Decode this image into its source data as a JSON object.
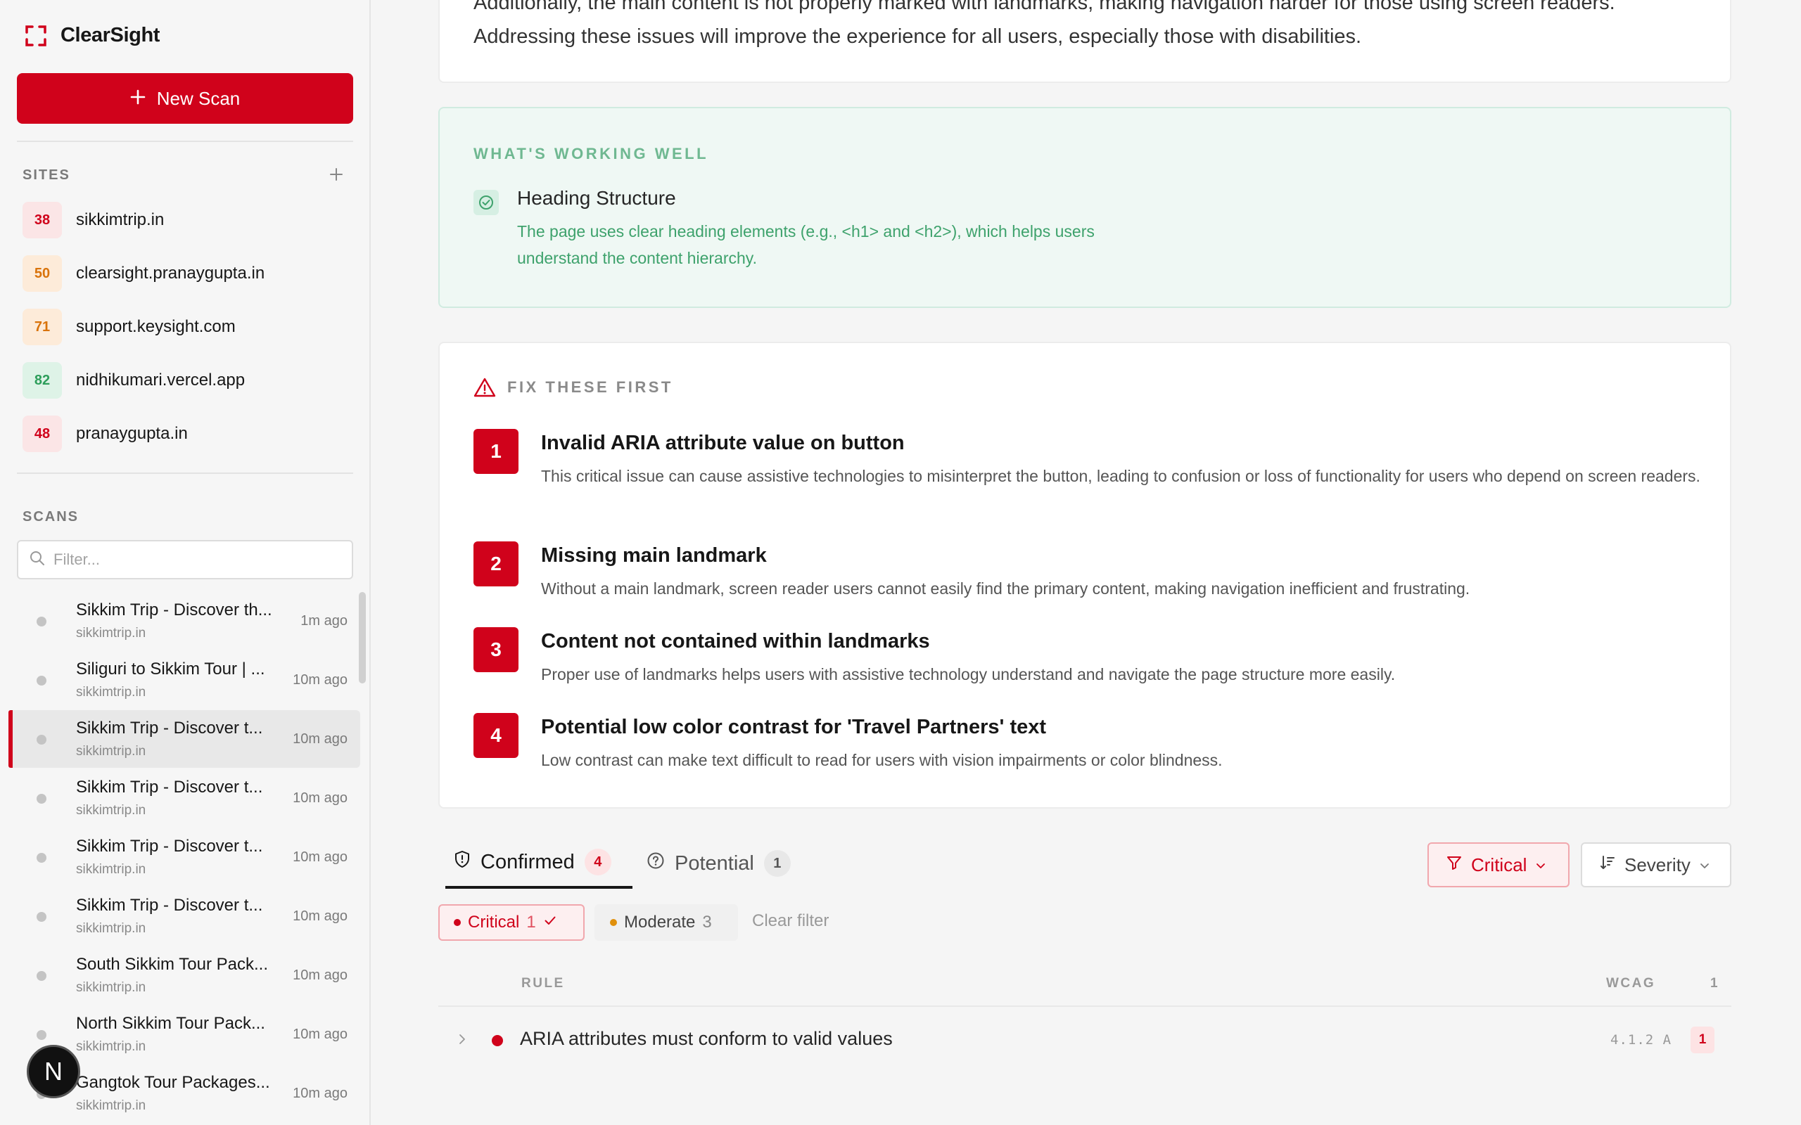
{
  "app": {
    "name": "ClearSight"
  },
  "sidebar": {
    "new_scan_label": "New Scan",
    "sites_label": "SITES",
    "sites": [
      {
        "score": "38",
        "name": "sikkimtrip.in",
        "bg": "#fbe5e6",
        "fg": "#d0021b"
      },
      {
        "score": "50",
        "name": "clearsight.pranaygupta.in",
        "bg": "#fdebd9",
        "fg": "#d9730b"
      },
      {
        "score": "71",
        "name": "support.keysight.com",
        "bg": "#fdebd9",
        "fg": "#d9730b"
      },
      {
        "score": "82",
        "name": "nidhikumari.vercel.app",
        "bg": "#def3e7",
        "fg": "#2e9e5b"
      },
      {
        "score": "48",
        "name": "pranaygupta.in",
        "bg": "#fbe5e6",
        "fg": "#d0021b"
      }
    ],
    "scans_label": "SCANS",
    "filter_placeholder": "Filter...",
    "scans": [
      {
        "title": "Sikkim Trip - Discover th...",
        "site": "sikkimtrip.in",
        "time": "1m ago"
      },
      {
        "title": "Siliguri to Sikkim Tour | ...",
        "site": "sikkimtrip.in",
        "time": "10m ago"
      },
      {
        "title": "Sikkim Trip - Discover t...",
        "site": "sikkimtrip.in",
        "time": "10m ago"
      },
      {
        "title": "Sikkim Trip - Discover t...",
        "site": "sikkimtrip.in",
        "time": "10m ago"
      },
      {
        "title": "Sikkim Trip - Discover t...",
        "site": "sikkimtrip.in",
        "time": "10m ago"
      },
      {
        "title": "Sikkim Trip - Discover t...",
        "site": "sikkimtrip.in",
        "time": "10m ago"
      },
      {
        "title": "South Sikkim Tour Pack...",
        "site": "sikkimtrip.in",
        "time": "10m ago"
      },
      {
        "title": "North Sikkim Tour Pack...",
        "site": "sikkimtrip.in",
        "time": "10m ago"
      },
      {
        "title": "Gangtok Tour Packages...",
        "site": "sikkimtrip.in",
        "time": "10m ago"
      }
    ],
    "active_scan_index": 2,
    "n_badge": "N"
  },
  "summary": {
    "line1": "Additionally, the main content is not properly marked with landmarks, making navigation harder for those using screen readers.",
    "line2": "Addressing these issues will improve the experience for all users, especially those with disabilities."
  },
  "working_well": {
    "heading": "WHAT'S WORKING WELL",
    "items": [
      {
        "title": "Heading Structure",
        "description": "The page uses clear heading elements (e.g., <h1> and <h2>), which helps users understand the content hierarchy."
      }
    ]
  },
  "fix_first": {
    "heading": "FIX THESE FIRST",
    "items": [
      {
        "num": "1",
        "title": "Invalid ARIA attribute value on button",
        "description": "This critical issue can cause assistive technologies to misinterpret the button, leading to confusion or loss of functionality for users who depend on screen readers."
      },
      {
        "num": "2",
        "title": "Missing main landmark",
        "description": "Without a main landmark, screen reader users cannot easily find the primary content, making navigation inefficient and frustrating."
      },
      {
        "num": "3",
        "title": "Content not contained within landmarks",
        "description": "Proper use of landmarks helps users with assistive technology understand and navigate the page structure more easily."
      },
      {
        "num": "4",
        "title": "Potential low color contrast for 'Travel Partners' text",
        "description": "Low contrast can make text difficult to read for users with vision impairments or color blindness."
      }
    ]
  },
  "tabs": {
    "confirmed": {
      "label": "Confirmed",
      "count": "4"
    },
    "potential": {
      "label": "Potential",
      "count": "1"
    }
  },
  "filters": {
    "critical_button": "Critical",
    "severity_button": "Severity",
    "chips": {
      "critical": {
        "label": "Critical",
        "count": "1"
      },
      "moderate": {
        "label": "Moderate",
        "count": "3"
      }
    },
    "clear_filter": "Clear filter"
  },
  "table": {
    "headers": {
      "rule": "RULE",
      "wcag": "WCAG",
      "count": "1"
    },
    "rows": [
      {
        "rule": "ARIA attributes must conform to valid values",
        "wcag": "4.1.2 A",
        "count": "1"
      }
    ]
  },
  "colors": {
    "accent": "#d0021b",
    "success": "#3ea26c",
    "moderate": "#e0900b"
  }
}
